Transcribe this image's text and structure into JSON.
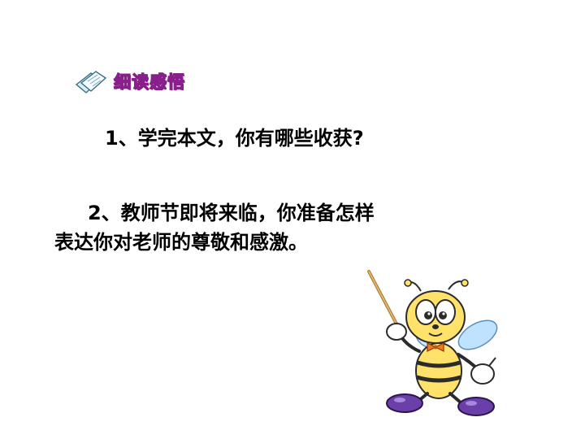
{
  "header": {
    "section_label": "细读感悟",
    "icon": "notes-icon"
  },
  "questions": {
    "q1": "1、学完本文，你有哪些收获?",
    "q2_line1": "2、教师节即将来临，你准备怎样",
    "q2_line2": "表达你对老师的尊敬和感激。"
  },
  "illustration": {
    "name": "bee-teacher-with-pointer",
    "colors": {
      "body_yellow": "#ffe26a",
      "stripe_dark": "#2b2b2b",
      "wing_blue": "#bfe3ff",
      "shoe_purple": "#6b3fa8",
      "pointer_tan": "#c99a4a",
      "bow_orange": "#f07a1e"
    }
  },
  "colors": {
    "background": "#ffffff",
    "tag_fill": "#f6c6ee",
    "tag_stroke": "#8a1e8c",
    "text": "#000000"
  }
}
